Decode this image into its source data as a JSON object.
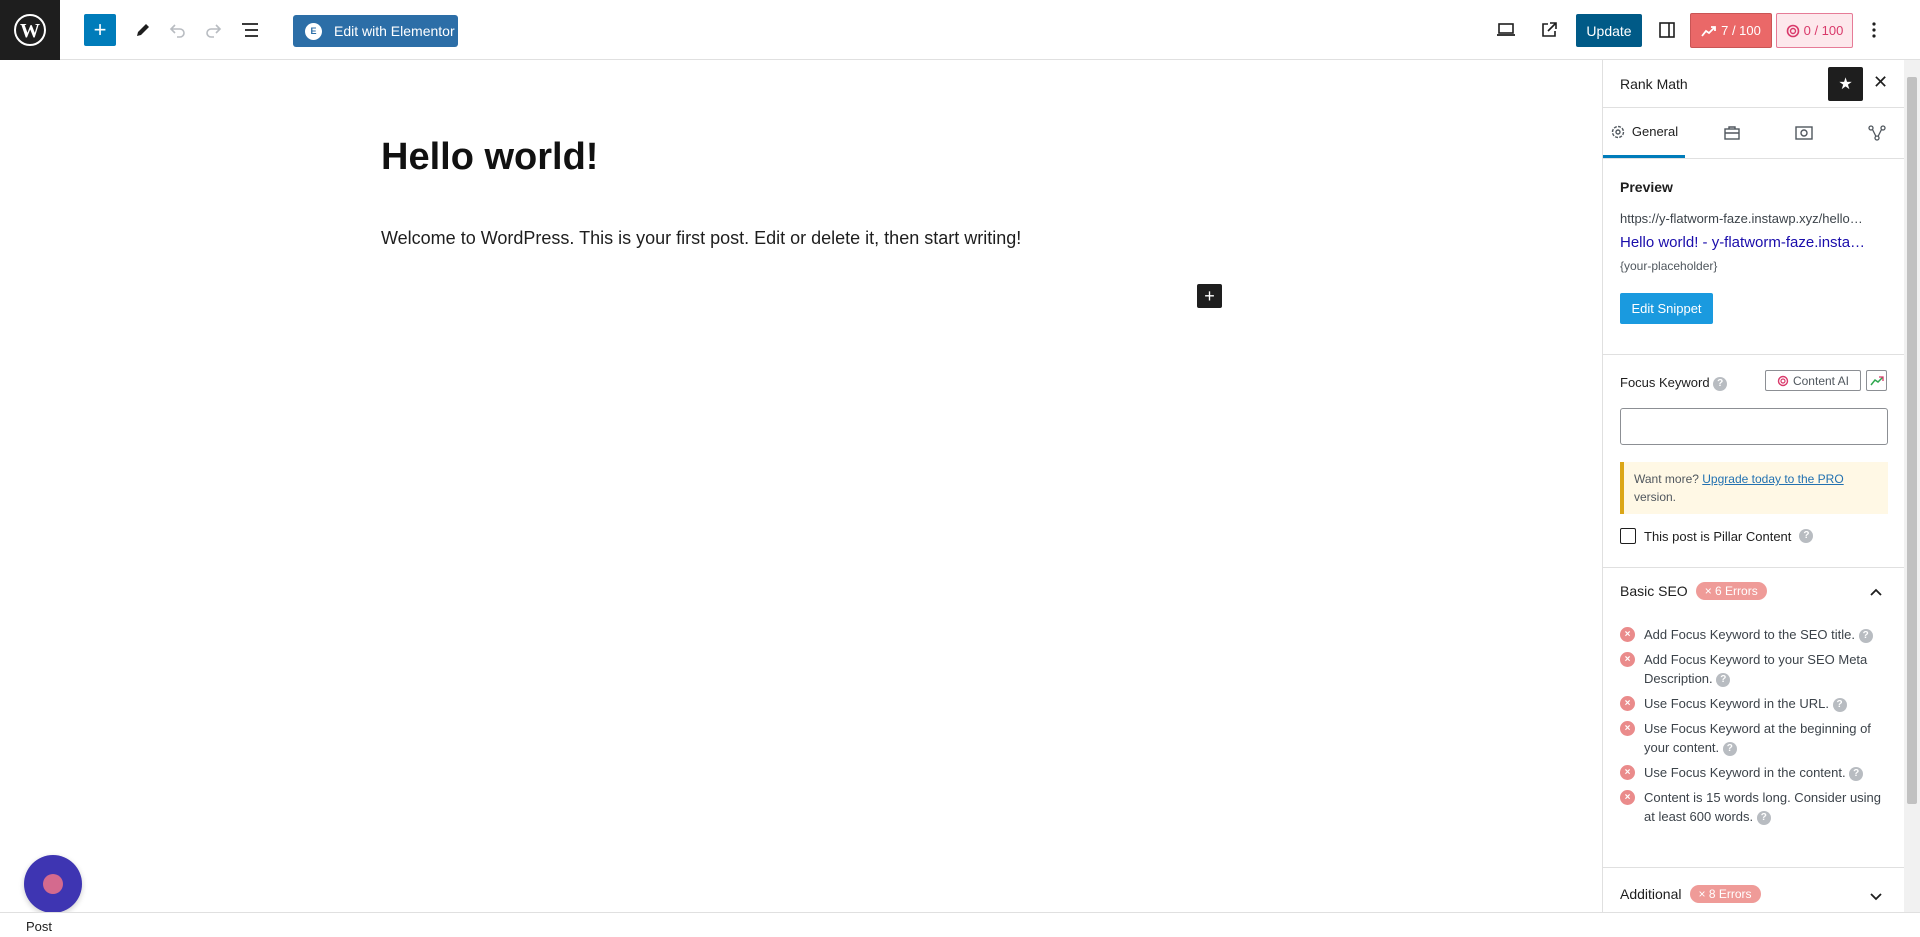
{
  "toolbar": {
    "add_label": "+",
    "elementor_label": "Edit with Elementor",
    "elementor_badge": "E",
    "update_label": "Update",
    "seo_score": "7 / 100",
    "content_ai_score": "0 / 100"
  },
  "editor": {
    "title": "Hello world!",
    "paragraph": "Welcome to WordPress. This is your first post. Edit or delete it, then start writing!",
    "inline_add": "+"
  },
  "status_bar": {
    "label": "Post"
  },
  "sidebar": {
    "title": "Rank Math",
    "tabs": {
      "general": "General"
    },
    "preview": {
      "heading": "Preview",
      "url": "https://y-flatworm-faze.instawp.xyz/hello…",
      "title_link": "Hello world! - y-flatworm-faze.insta…",
      "description": "{your-placeholder}",
      "edit_snippet": "Edit Snippet"
    },
    "focus": {
      "label": "Focus Keyword",
      "content_ai": "Content AI",
      "input_value": "",
      "notice_prefix": "Want more?",
      "notice_link": "Upgrade today to the PRO",
      "notice_suffix": "version.",
      "pillar_label": "This post is Pillar Content"
    },
    "basic_seo": {
      "label": "Basic SEO",
      "badge": "× 6 Errors",
      "items": [
        "Add Focus Keyword to the SEO title.",
        "Add Focus Keyword to your SEO Meta Description.",
        "Use Focus Keyword in the URL.",
        "Use Focus Keyword at the beginning of your content.",
        "Use Focus Keyword in the content.",
        "Content is 15 words long. Consider using at least 600 words."
      ]
    },
    "additional": {
      "label": "Additional",
      "badge": "× 8 Errors"
    }
  },
  "colors": {
    "primary": "#007cba",
    "elementor": "#2c6ea7",
    "update": "#005a87",
    "score_bad": "#ea6868",
    "error": "#ea8b8b"
  }
}
